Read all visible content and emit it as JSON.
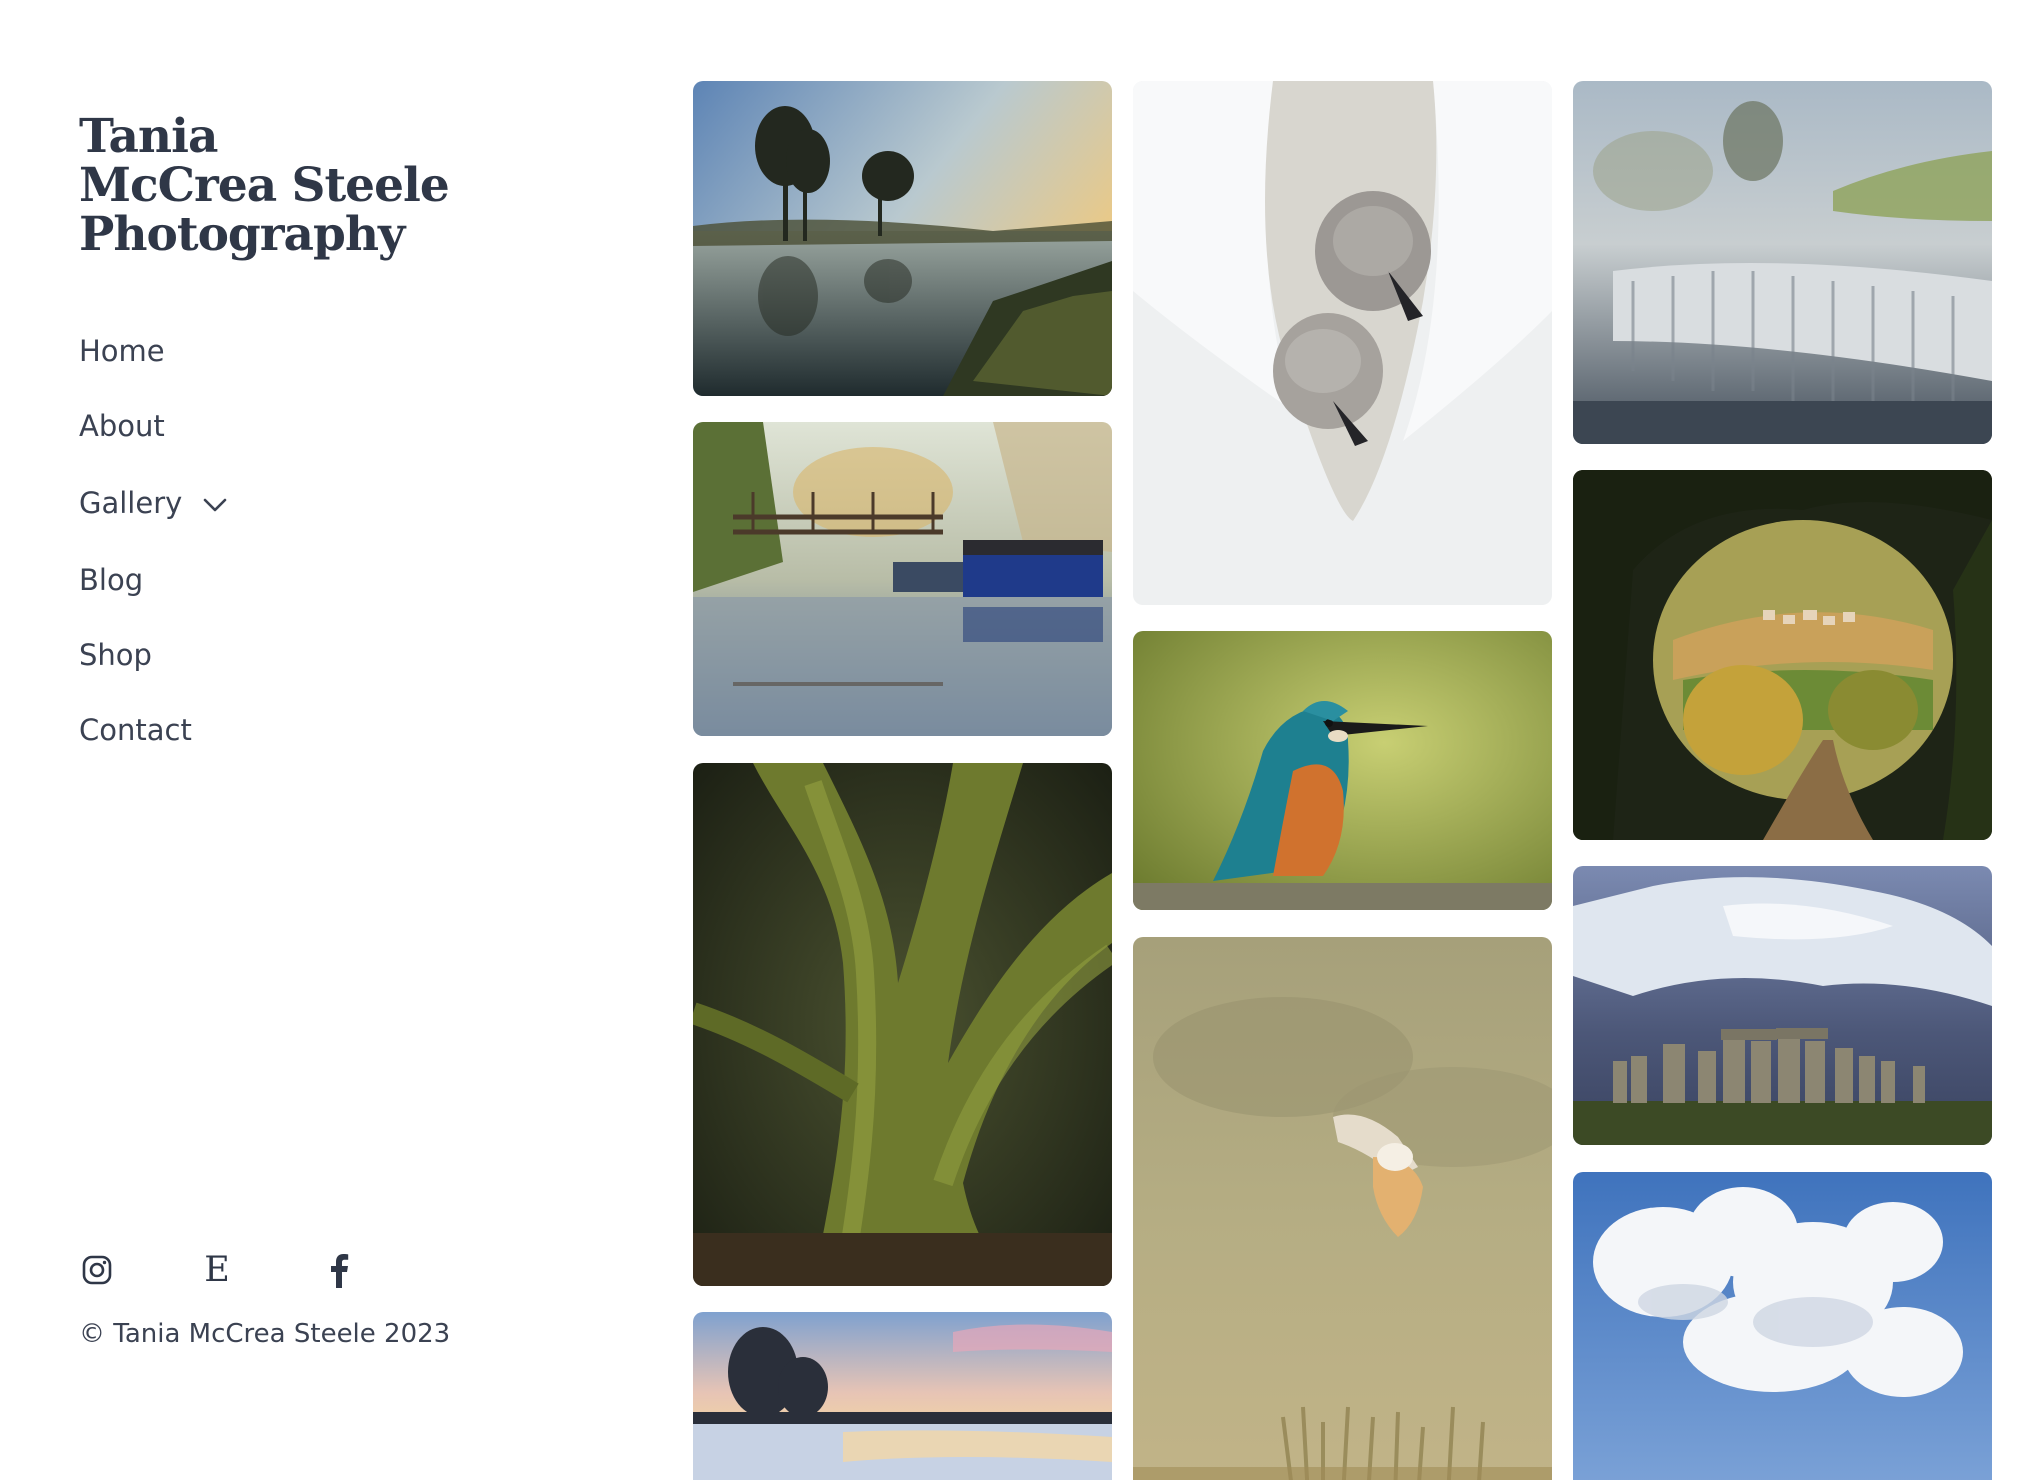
{
  "site": {
    "title_lines": [
      "Tania",
      "McCrea Steele",
      "Photography"
    ]
  },
  "nav": {
    "items": [
      {
        "label": "Home"
      },
      {
        "label": "About"
      },
      {
        "label": "Gallery",
        "has_dropdown": true
      },
      {
        "label": "Blog"
      },
      {
        "label": "Shop"
      },
      {
        "label": "Contact"
      }
    ]
  },
  "social": {
    "icons": [
      "instagram-icon",
      "etsy-icon",
      "facebook-icon"
    ],
    "etsy_glyph": "E"
  },
  "footer": {
    "copyright": "© Tania McCrea Steele 2023"
  },
  "gallery": {
    "images": [
      {
        "subject": "misty river at sunrise with trees"
      },
      {
        "subject": "narrowboats by a footbridge on a misty canal"
      },
      {
        "subject": "moss-covered tree in woodland"
      },
      {
        "subject": "frosty river with trees at dawn"
      },
      {
        "subject": "two cygnets nestled in swan feathers"
      },
      {
        "subject": "kingfisher perched"
      },
      {
        "subject": "barn owl in flight"
      },
      {
        "subject": "misty weir waterfall"
      },
      {
        "subject": "countryside village seen through tree arch"
      },
      {
        "subject": "Stonehenge under stormy sky"
      },
      {
        "subject": "white clouds in blue sky"
      }
    ]
  },
  "colors": {
    "text": "#2f3747",
    "background": "#ffffff"
  }
}
